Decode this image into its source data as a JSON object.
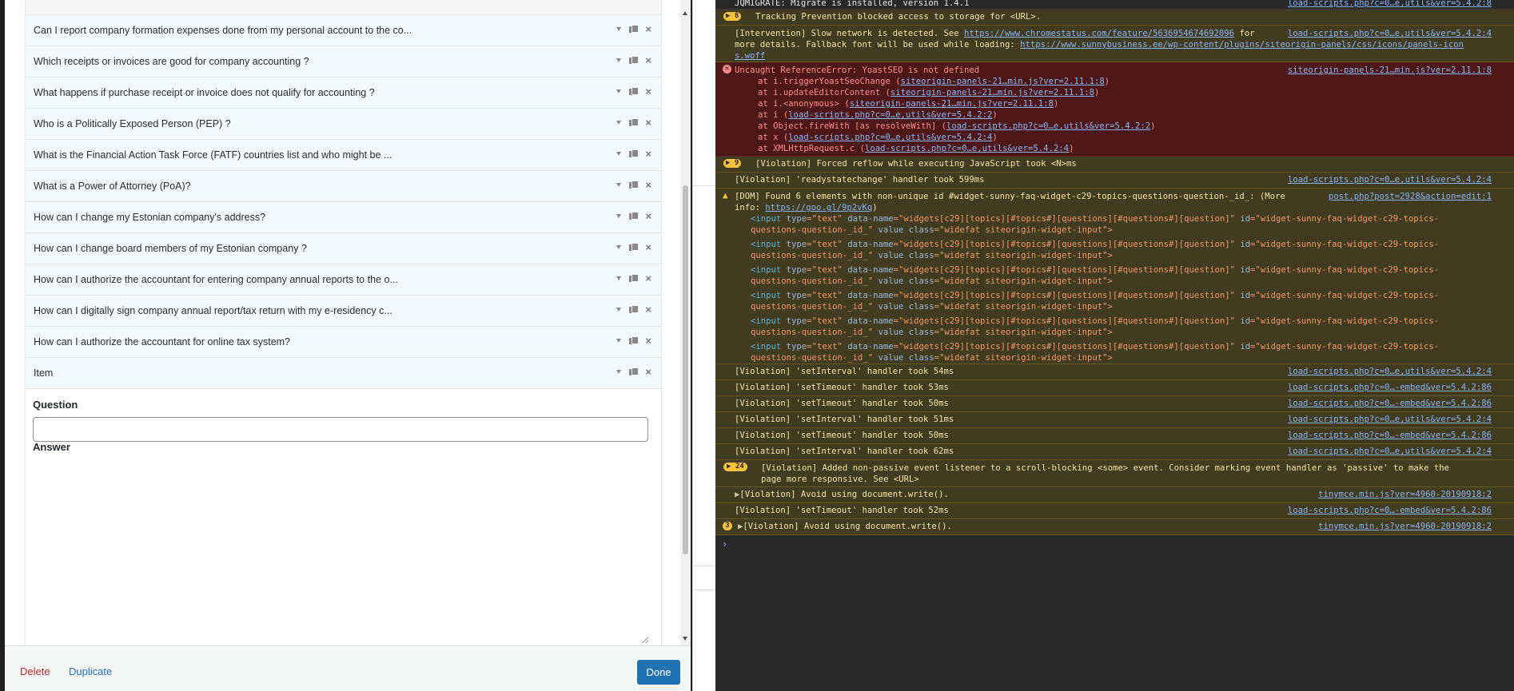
{
  "dialog": {
    "items": [
      "Can I report company formation expenses done from my personal account to the co...",
      "Which receipts or invoices are good for company accounting ?",
      "What happens if purchase receipt or invoice does not qualify for accounting ?",
      "Who is a Politically Exposed Person (PEP) ?",
      "What is the Financial Action Task Force (FATF) countries list and who might be ...",
      "What is a Power of Attorney (PoA)?",
      "How can I change my Estonian company's address?",
      "How can I change board members of my Estonian company ?",
      "How can I authorize the accountant for entering company annual reports to the o...",
      "How can I digitally sign company annual report/tax return with my e-residency c...",
      "How can I authorize the accountant for online tax system?",
      "Item"
    ],
    "question_label": "Question",
    "answer_label": "Answer",
    "question_value": "",
    "footer": {
      "delete": "Delete",
      "duplicate": "Duplicate",
      "done": "Done"
    }
  },
  "console": {
    "jqmigrate": {
      "msg": "JQMIGRATE: Migrate is installed, version 1.4.1",
      "src": "load-scripts.php?c=0…e,utils&ver=5.4.2:8"
    },
    "tracking": {
      "count": "8",
      "msg": "Tracking Prevention blocked access to storage for <URL>."
    },
    "intervention": {
      "line1_pre": "[Intervention] Slow network is detected. See ",
      "line1_link": "https://www.chromestatus.com/feature/5636954674692096",
      "line1_post": " for",
      "src": "load-scripts.php?c=0…e,utils&ver=5.4.2:4",
      "line2_pre": "more details. Fallback font will be used while loading: ",
      "line2_link": "https://www.sunnybusiness.ee/wp-content/plugins/siteorigin-panels/css/icons/panels-icon",
      "line3_link": "s.woff"
    },
    "error": {
      "msg": "Uncaught ReferenceError: YoastSEO is not defined",
      "src": "siteorigin-panels-21…min.js?ver=2.11.1:8",
      "stack": [
        {
          "pre": "at i.triggerYoastSeoChange (",
          "link": "siteorigin-panels-21…min.js?ver=2.11.1:8",
          "post": ")"
        },
        {
          "pre": "at i.updateEditorContent (",
          "link": "siteorigin-panels-21…min.js?ver=2.11.1:8",
          "post": ")"
        },
        {
          "pre": "at i.<anonymous> (",
          "link": "siteorigin-panels-21…min.js?ver=2.11.1:8",
          "post": ")"
        },
        {
          "pre": "at i (",
          "link": "load-scripts.php?c=0…e,utils&ver=5.4.2:2",
          "post": ")"
        },
        {
          "pre": "at Object.fireWith [as resolveWith] (",
          "link": "load-scripts.php?c=0…e,utils&ver=5.4.2:2",
          "post": ")"
        },
        {
          "pre": "at x (",
          "link": "load-scripts.php?c=0…e,utils&ver=5.4.2:4",
          "post": ")"
        },
        {
          "pre": "at XMLHttpRequest.c (",
          "link": "load-scripts.php?c=0…e,utils&ver=5.4.2:4",
          "post": ")"
        }
      ]
    },
    "reflow": {
      "count": "9",
      "msg": "[Violation] Forced reflow while executing JavaScript took <N>ms"
    },
    "readystate": {
      "msg": "[Violation] 'readystatechange' handler took 599ms",
      "src": "load-scripts.php?c=0…e,utils&ver=5.4.2:4"
    },
    "dom": {
      "msg": "[DOM] Found 6 elements with non-unique id #widget-sunny-faq-widget-c29-topics-questions-question-_id_: (More",
      "src": "post.php?post=2928&action=edit:1",
      "info_pre": "info: ",
      "info_link": "https://goo.gl/9p2vKq",
      "info_post": ")",
      "input_l1": [
        "<input ",
        "type",
        "=\"",
        "text",
        "\" ",
        "data-name",
        "=\"",
        "widgets[c29][topics][#topics#][questions][#questions#][question]",
        "\" ",
        "id",
        "=\"",
        "widget-sunny-faq-widget-c29-topics-"
      ],
      "input_l2": [
        "questions-question-_id_",
        "\" ",
        "value",
        " ",
        "class",
        "=\"",
        "widefat siteorigin-widget-input",
        "\">"
      ],
      "repeat": 6
    },
    "violations": [
      {
        "msg": "[Violation] 'setInterval' handler took 54ms",
        "src": "load-scripts.php?c=0…e,utils&ver=5.4.2:4"
      },
      {
        "msg": "[Violation] 'setTimeout' handler took 53ms",
        "src": "load-scripts.php?c=0…-embed&ver=5.4.2:86"
      },
      {
        "msg": "[Violation] 'setTimeout' handler took 50ms",
        "src": "load-scripts.php?c=0…-embed&ver=5.4.2:86"
      },
      {
        "msg": "[Violation] 'setInterval' handler took 51ms",
        "src": "load-scripts.php?c=0…e,utils&ver=5.4.2:4"
      },
      {
        "msg": "[Violation] 'setTimeout' handler took 50ms",
        "src": "load-scripts.php?c=0…-embed&ver=5.4.2:86"
      },
      {
        "msg": "[Violation] 'setInterval' handler took 62ms",
        "src": "load-scripts.php?c=0…e,utils&ver=5.4.2:4"
      }
    ],
    "nonpassive": {
      "count": "24",
      "line1": "[Violation] Added non-passive event listener to a scroll-blocking <some> event. Consider marking event handler as 'passive' to make the",
      "line2": "page more responsive. See <URL>"
    },
    "docwrite1": {
      "msg": "[Violation] Avoid using document.write().",
      "src": "tinymce.min.js?ver=4960-20190918:2"
    },
    "settimeout52": {
      "msg": "[Violation] 'setTimeout' handler took 52ms",
      "src": "load-scripts.php?c=0…-embed&ver=5.4.2:86"
    },
    "docwrite2": {
      "count": "3",
      "msg": "[Violation] Avoid using document.write().",
      "src": "tinymce.min.js?ver=4960-20190918:2"
    }
  }
}
